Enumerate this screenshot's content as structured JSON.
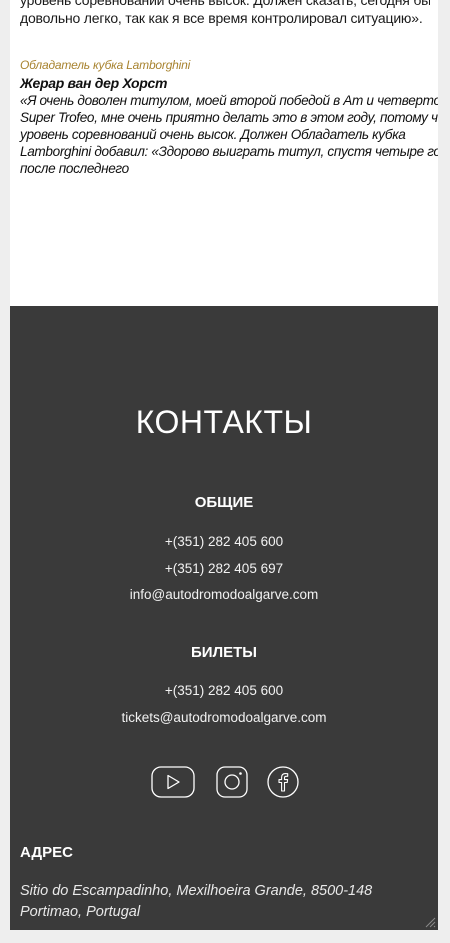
{
  "article": {
    "cut_line_1": "уровень соревнований очень высок. Должен сказать, сегодня было",
    "cut_line_2": "довольно легко, так как я все время контролировал ситуацию».",
    "quote_kicker": "Обладатель кубка Lamborghini",
    "quote_author": "Жерар ван дер Хорст",
    "quote_lines": [
      "«Я очень доволен титулом, моей второй победой в Am и четвертой в",
      "Super Trofeo, мне очень приятно делать это в этом году, потому что",
      "уровень соревнований очень высок. Должен Обладатель кубка",
      "Lamborghini добавил: «Здорово выиграть титул, спустя четыре года",
      "после последнего"
    ]
  },
  "footer": {
    "title": "КОНТАКТЫ",
    "general": {
      "title": "ОБЩИЕ",
      "phone_1": "+(351) 282 405 600",
      "phone_2": "+(351) 282 405 697",
      "email": "info@autodromodoalgarve.com"
    },
    "tickets": {
      "title": "БИЛЕТЫ",
      "phone": "+(351) 282 405 600",
      "email": "tickets@autodromodoalgarve.com"
    },
    "socials": [
      {
        "name": "youtube-icon"
      },
      {
        "name": "instagram-icon"
      },
      {
        "name": "facebook-icon"
      }
    ],
    "address": {
      "title": "АДРЕС",
      "text": "Sitio do Escampadinho, Mexilhoeira Grande, 8500-148 Portimao, Portugal"
    }
  },
  "colors": {
    "footer_bg": "#3a3a3a",
    "accent_gold": "#a8832f",
    "page_bg": "#eeeeee"
  }
}
